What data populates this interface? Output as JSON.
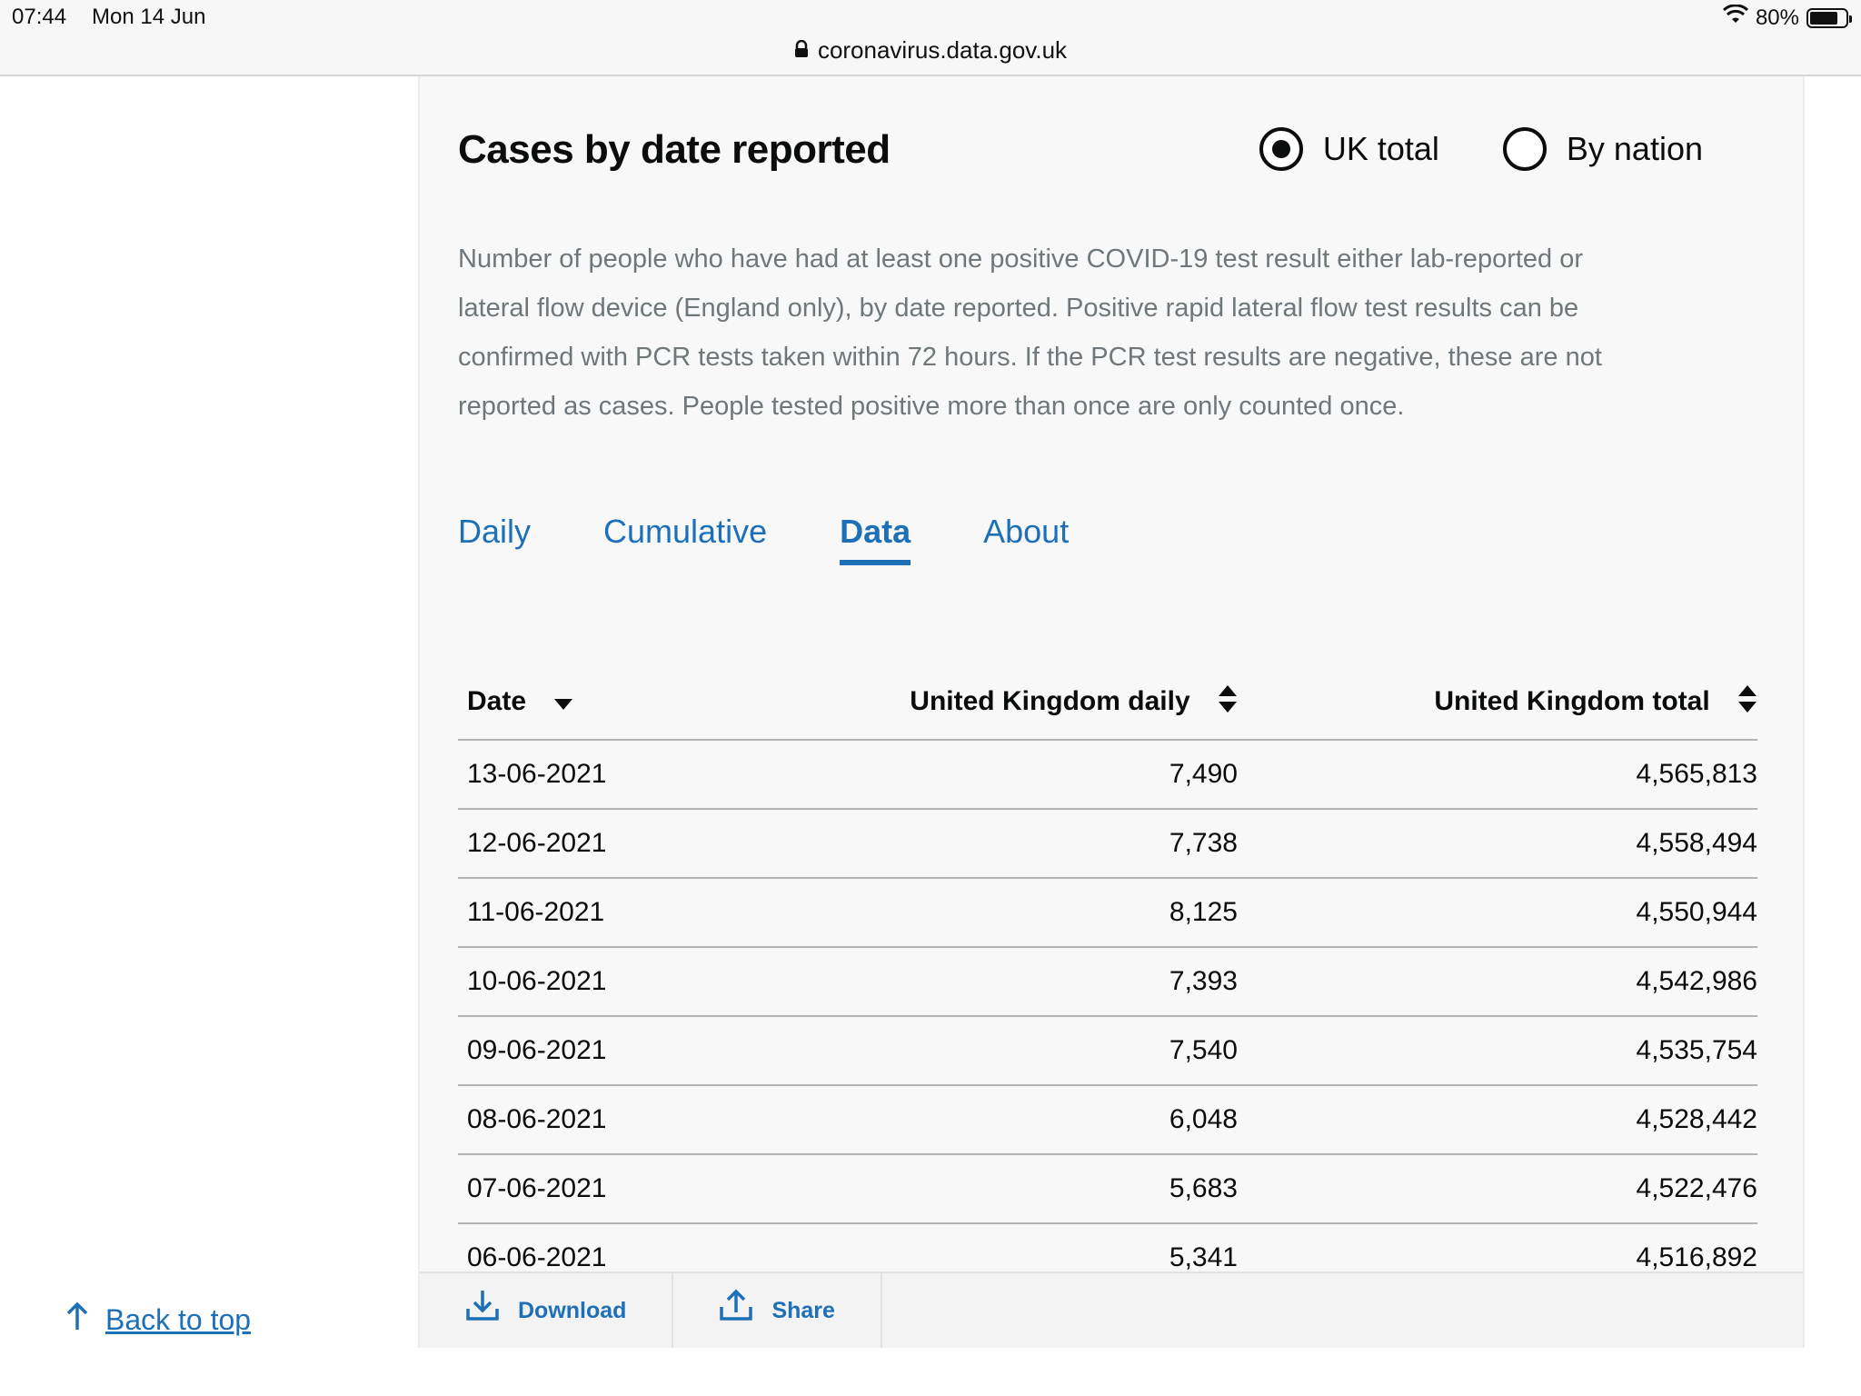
{
  "status_bar": {
    "time": "07:44",
    "date": "Mon 14 Jun",
    "battery_text": "80%",
    "battery_level": 0.8
  },
  "browser": {
    "url": "coronavirus.data.gov.uk"
  },
  "card": {
    "title": "Cases by date reported",
    "radio_options": [
      {
        "label": "UK total",
        "selected": true
      },
      {
        "label": "By nation",
        "selected": false
      }
    ],
    "description": "Number of people who have had at least one positive COVID-19 test result either lab-reported or lateral flow device (England only), by date reported. Positive rapid lateral flow test results can be confirmed with PCR tests taken within 72 hours. If the PCR test results are negative, these are not reported as cases. People tested positive more than once are only counted once.",
    "tabs": [
      {
        "label": "Daily",
        "active": false
      },
      {
        "label": "Cumulative",
        "active": false
      },
      {
        "label": "Data",
        "active": true
      },
      {
        "label": "About",
        "active": false
      }
    ],
    "table": {
      "headers": [
        "Date",
        "United Kingdom daily",
        "United Kingdom total"
      ],
      "rows": [
        [
          "13-06-2021",
          "7,490",
          "4,565,813"
        ],
        [
          "12-06-2021",
          "7,738",
          "4,558,494"
        ],
        [
          "11-06-2021",
          "8,125",
          "4,550,944"
        ],
        [
          "10-06-2021",
          "7,393",
          "4,542,986"
        ],
        [
          "09-06-2021",
          "7,540",
          "4,535,754"
        ],
        [
          "08-06-2021",
          "6,048",
          "4,528,442"
        ],
        [
          "07-06-2021",
          "5,683",
          "4,522,476"
        ],
        [
          "06-06-2021",
          "5,341",
          "4,516,892"
        ]
      ]
    },
    "footer": {
      "download_label": "Download",
      "share_label": "Share"
    }
  },
  "back_to_top": "Back to top",
  "colors": {
    "link_blue": "#1d70b8",
    "text_dark": "#0b0c0c",
    "text_muted": "#6f777b",
    "card_bg": "#f8f8f8"
  }
}
